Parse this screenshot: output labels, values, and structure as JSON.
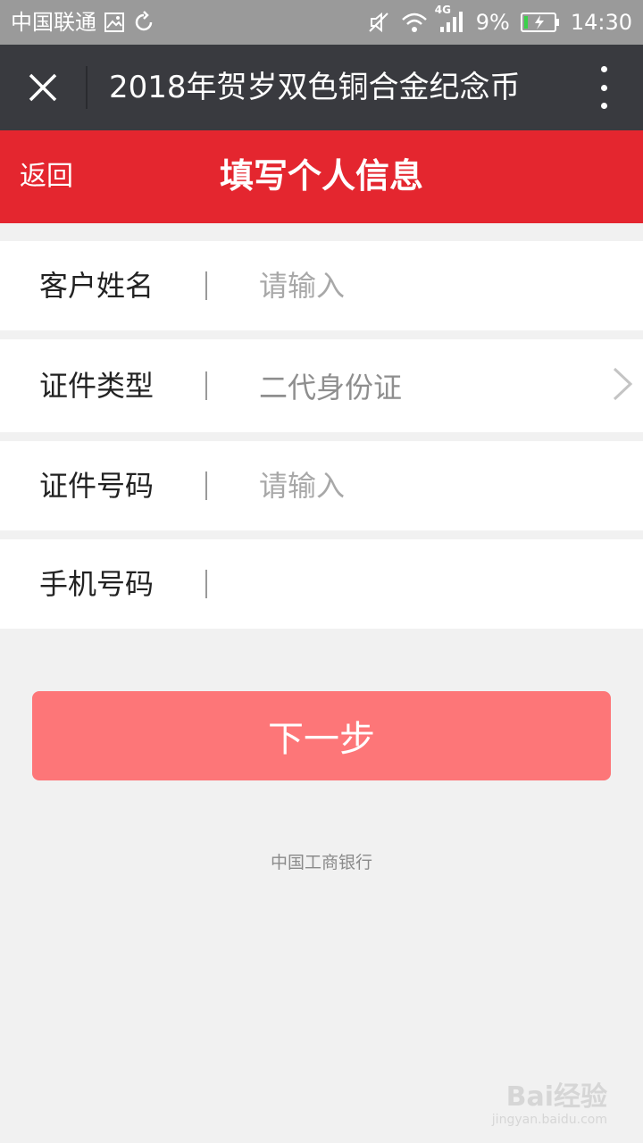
{
  "status_bar": {
    "carrier": "中国联通",
    "network": "4G",
    "battery": "9%",
    "time": "14:30",
    "icons": [
      "image-icon",
      "sync-icon",
      "mute-icon",
      "wifi-icon",
      "signal-icon",
      "battery-charging-icon"
    ]
  },
  "topbar": {
    "title": "2018年贺岁双色铜合金纪念币",
    "close_icon": "close-icon",
    "more_icon": "more-vertical-icon"
  },
  "header": {
    "back_label": "返回",
    "title": "填写个人信息"
  },
  "form": {
    "name": {
      "label": "客户姓名",
      "placeholder": "请输入",
      "value": ""
    },
    "id_type": {
      "label": "证件类型",
      "value": "二代身份证"
    },
    "id_number": {
      "label": "证件号码",
      "placeholder": "请输入",
      "value": ""
    },
    "phone": {
      "label": "手机号码",
      "placeholder": "",
      "value": ""
    }
  },
  "next_button": {
    "label": "下一步"
  },
  "footer": {
    "text": "中国工商银行"
  },
  "watermark": {
    "main": "Bai经验",
    "sub": "jingyan.baidu.com"
  },
  "colors": {
    "status_bar": "#9a9a9a",
    "topbar": "#393a3f",
    "header_red": "#e4262f",
    "button": "#fd7678",
    "background": "#f1f1f1"
  }
}
